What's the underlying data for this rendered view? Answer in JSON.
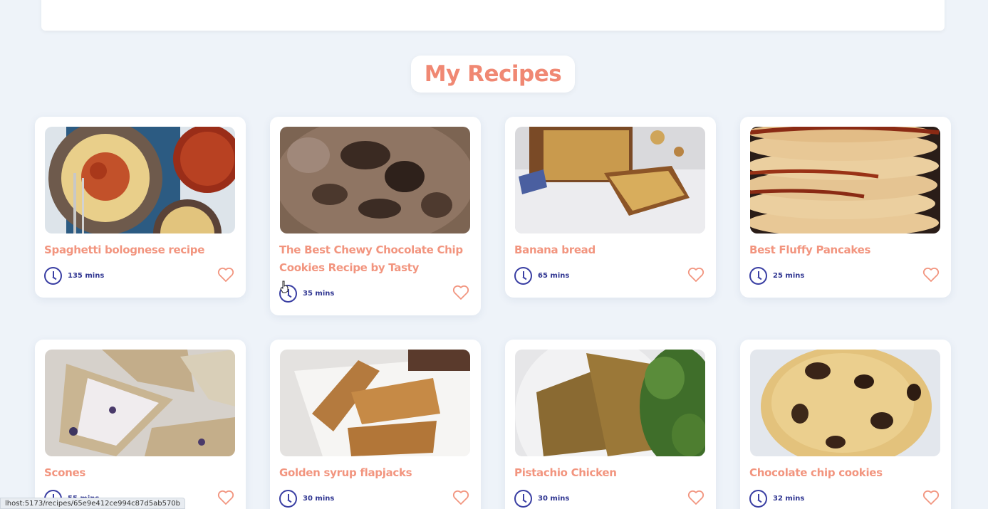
{
  "header": {
    "title": "My Recipes"
  },
  "recipes": [
    {
      "title": "Spaghetti bolognese recipe",
      "time": "135 mins"
    },
    {
      "title": "The Best Chewy Chocolate Chip Cookies Recipe by Tasty",
      "time": "35 mins"
    },
    {
      "title": "Banana bread",
      "time": "65 mins"
    },
    {
      "title": "Best Fluffy Pancakes",
      "time": "25 mins"
    },
    {
      "title": "Scones",
      "time": "55 mins"
    },
    {
      "title": "Golden syrup flapjacks",
      "time": "30 mins"
    },
    {
      "title": "Pistachio Chicken",
      "time": "30 mins"
    },
    {
      "title": "Chocolate chip cookies",
      "time": "32 mins"
    }
  ],
  "status_bar": {
    "url": "lhost:5173/recipes/65e9e412ce994c87d5ab570b"
  },
  "colors": {
    "accent": "#f08873",
    "time": "#2f3591",
    "background": "#eef3f9"
  }
}
